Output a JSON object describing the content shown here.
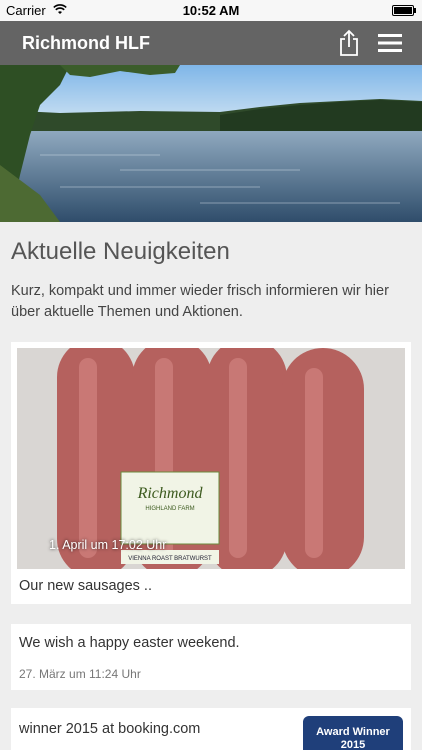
{
  "statusbar": {
    "carrier": "Carrier",
    "time": "10:52 AM"
  },
  "navbar": {
    "title": "Richmond HLF",
    "share_icon": "share-icon",
    "menu_icon": "hamburger-menu-icon"
  },
  "hero": {
    "alt": "lake landscape photo"
  },
  "news": {
    "title": "Aktuelle Neuigkeiten",
    "intro": "Kurz, kompakt und immer wieder frisch informieren wir hier über aktuelle Themen und Aktionen."
  },
  "posts": [
    {
      "timestamp": "1. April um 17:02 Uhr",
      "text": "Our new sausages ..",
      "label_brand": "Richmond",
      "label_sub": "HIGHLAND FARM",
      "label_product": "VIENNA ROAST BRATWURST"
    },
    {
      "text": "We wish a happy easter weekend.",
      "date": "27. März um 11:24 Uhr"
    },
    {
      "text": "winner 2015 at booking.com",
      "badge_line1": "Award Winner",
      "badge_line2": "2015"
    }
  ]
}
